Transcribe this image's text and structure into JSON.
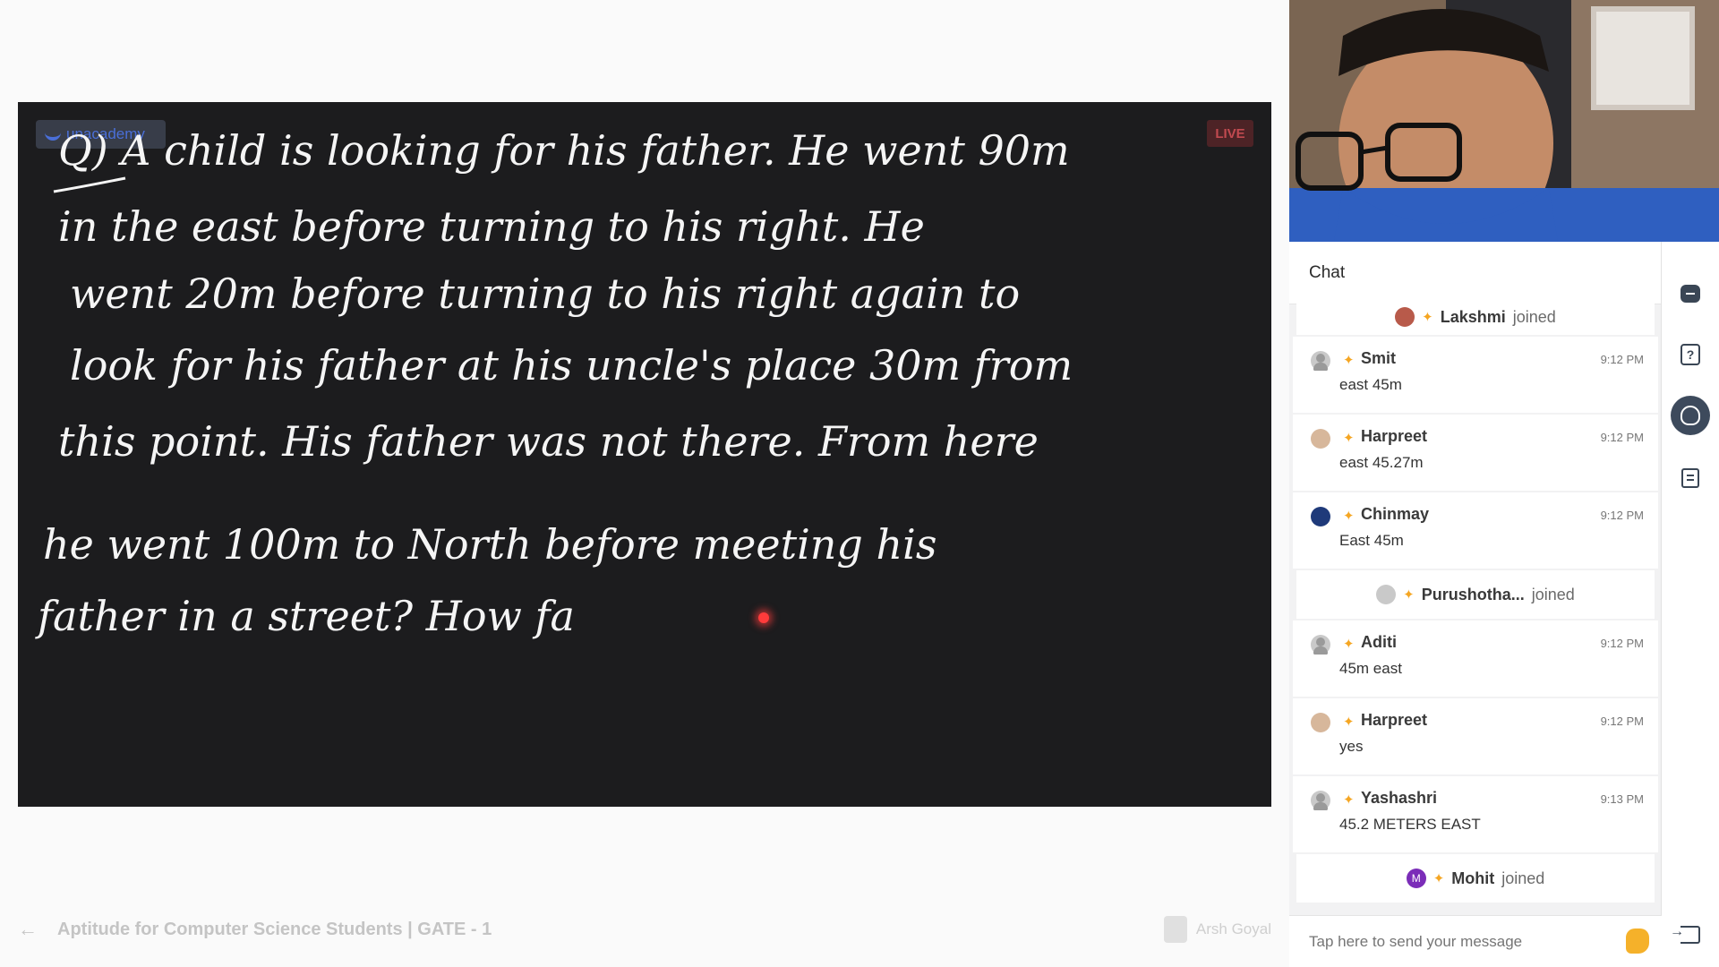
{
  "board": {
    "brand": "unacademy",
    "live_badge": "LIVE",
    "lines": [
      "Q) A child is looking for his father. He went 90m",
      "in the east before turning to his right. He",
      "went 20m before turning to his right again to",
      "look for his father at his uncle's place 30m from",
      "this point. His father was not there. From here",
      "he went 100m to North before meeting his",
      "father in a street? How fa"
    ]
  },
  "footer": {
    "course_title": "Aptitude for Computer Science Students | GATE - 1",
    "educator": "Arsh Goyal"
  },
  "chat": {
    "title": "Chat",
    "events": [
      {
        "kind": "joined",
        "name": "Lakshmi",
        "verb": "joined"
      },
      {
        "kind": "msg",
        "name": "Smit",
        "time": "9:12 PM",
        "text": "east 45m"
      },
      {
        "kind": "msg",
        "name": "Harpreet",
        "time": "9:12 PM",
        "text": "east 45.27m"
      },
      {
        "kind": "msg",
        "name": "Chinmay",
        "time": "9:12 PM",
        "text": "East 45m"
      },
      {
        "kind": "joined",
        "name": "Purushotha...",
        "verb": "joined"
      },
      {
        "kind": "msg",
        "name": "Aditi",
        "time": "9:12 PM",
        "text": "45m east"
      },
      {
        "kind": "msg",
        "name": "Harpreet",
        "time": "9:12 PM",
        "text": "yes"
      },
      {
        "kind": "msg",
        "name": "Yashashri",
        "time": "9:13 PM",
        "text": "45.2 METERS EAST"
      },
      {
        "kind": "joined",
        "name": "Mohit",
        "verb": "joined",
        "initial": "M"
      }
    ],
    "input_placeholder": "Tap here to send your message"
  },
  "colors": {
    "board_bg": "#1c1c1e",
    "accent_spark": "#f5a623",
    "rail_active": "#3d4a5c"
  },
  "icons": {
    "rail": [
      "chat-icon",
      "question-icon",
      "raise-hand-icon",
      "notes-icon",
      "exit-icon"
    ]
  }
}
